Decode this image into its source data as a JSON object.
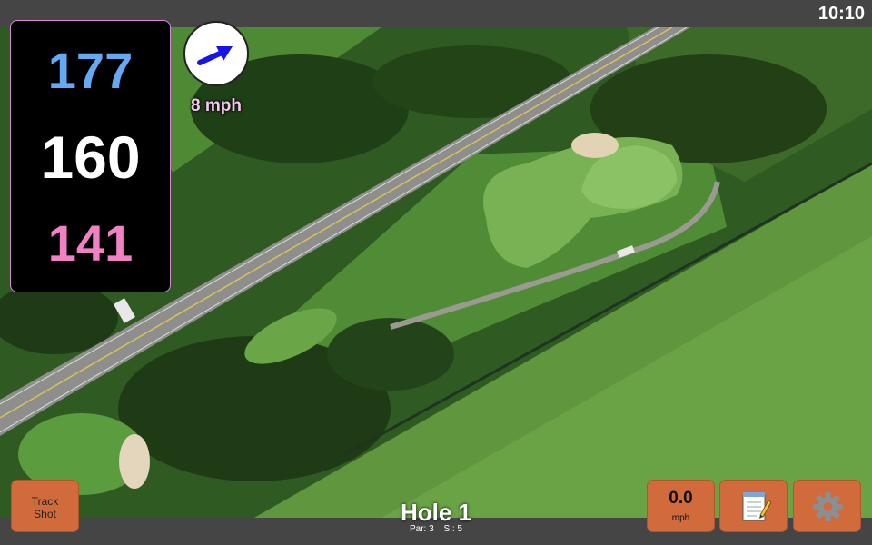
{
  "status": {
    "time": "10:10"
  },
  "distances": {
    "back": "177",
    "middle": "160",
    "front": "141"
  },
  "wind": {
    "speed": "8 mph",
    "direction_icon": "arrow-icon"
  },
  "buttons": {
    "track_shot": {
      "line1": "Track",
      "line2": "Shot"
    },
    "speed": {
      "value": "0.0",
      "unit": "mph"
    },
    "notes_icon": "notepad-icon",
    "settings_icon": "gear-icon"
  },
  "hole": {
    "title": "Hole 1",
    "par": "Par: 3",
    "si": "SI: 5"
  },
  "colors": {
    "back": "#63aaf2",
    "middle": "#ffffff",
    "front": "#f081c4",
    "button": "#d26b3c",
    "wind_label": "#f7c7ee"
  }
}
